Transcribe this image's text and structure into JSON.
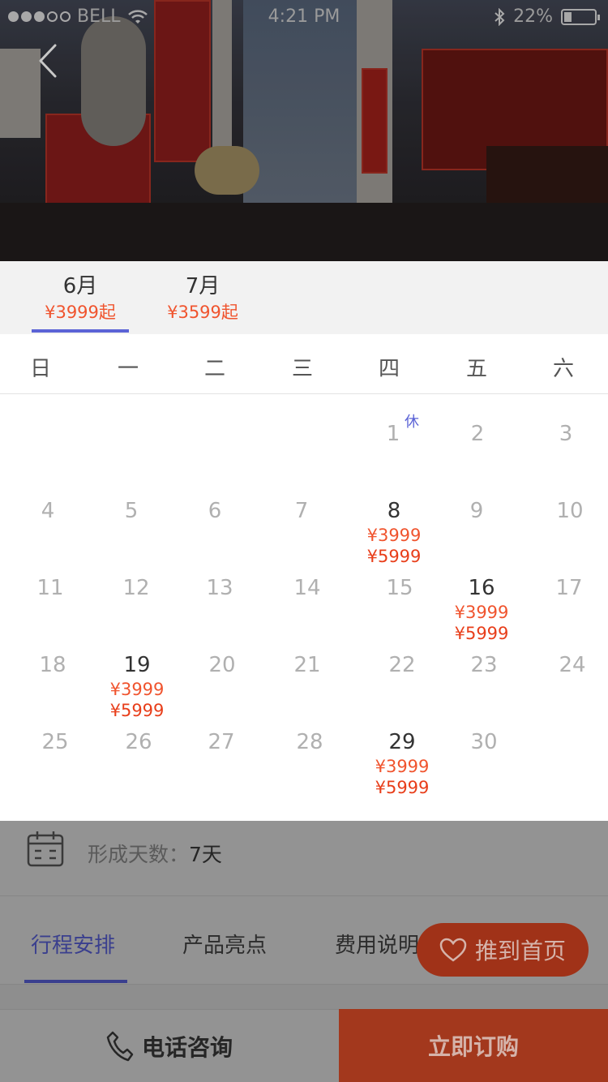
{
  "status_bar": {
    "carrier": "BELL",
    "time": "4:21 PM",
    "battery": "22%",
    "battery_level": 0.22
  },
  "month_tabs": [
    {
      "month": "6月",
      "price": "¥3999起",
      "selected": true
    },
    {
      "month": "7月",
      "price": "¥3599起",
      "selected": false
    }
  ],
  "weekdays": [
    "日",
    "一",
    "二",
    "三",
    "四",
    "五",
    "六"
  ],
  "calendar": {
    "rest_tag": "休",
    "days": [
      {
        "n": "1"
      },
      {
        "n": "2"
      },
      {
        "n": "3"
      },
      {
        "n": "4"
      },
      {
        "n": "5"
      },
      {
        "n": "6"
      },
      {
        "n": "7"
      },
      {
        "n": "8",
        "price1": "¥3999",
        "price2": "¥5999"
      },
      {
        "n": "9"
      },
      {
        "n": "10"
      },
      {
        "n": "11"
      },
      {
        "n": "12"
      },
      {
        "n": "13"
      },
      {
        "n": "14"
      },
      {
        "n": "15"
      },
      {
        "n": "16",
        "price1": "¥3999",
        "price2": "¥5999"
      },
      {
        "n": "17"
      },
      {
        "n": "18"
      },
      {
        "n": "19",
        "price1": "¥3999",
        "price2": "¥5999"
      },
      {
        "n": "20"
      },
      {
        "n": "21"
      },
      {
        "n": "22"
      },
      {
        "n": "23"
      },
      {
        "n": "24"
      },
      {
        "n": "25"
      },
      {
        "n": "26"
      },
      {
        "n": "27"
      },
      {
        "n": "28"
      },
      {
        "n": "29",
        "price1": "¥3999",
        "price2": "¥5999"
      },
      {
        "n": "30"
      }
    ]
  },
  "trip": {
    "label": "形成天数：",
    "value": "7天"
  },
  "section_tabs": [
    "行程安排",
    "产品亮点",
    "费用说明"
  ],
  "fab": {
    "label": "推到首页"
  },
  "bottom": {
    "phone_label": "电话咨询",
    "buy_label": "立即订购"
  },
  "colors": {
    "accent": "#5b63d6",
    "price": "#f0542e",
    "buy": "#a3381d"
  }
}
